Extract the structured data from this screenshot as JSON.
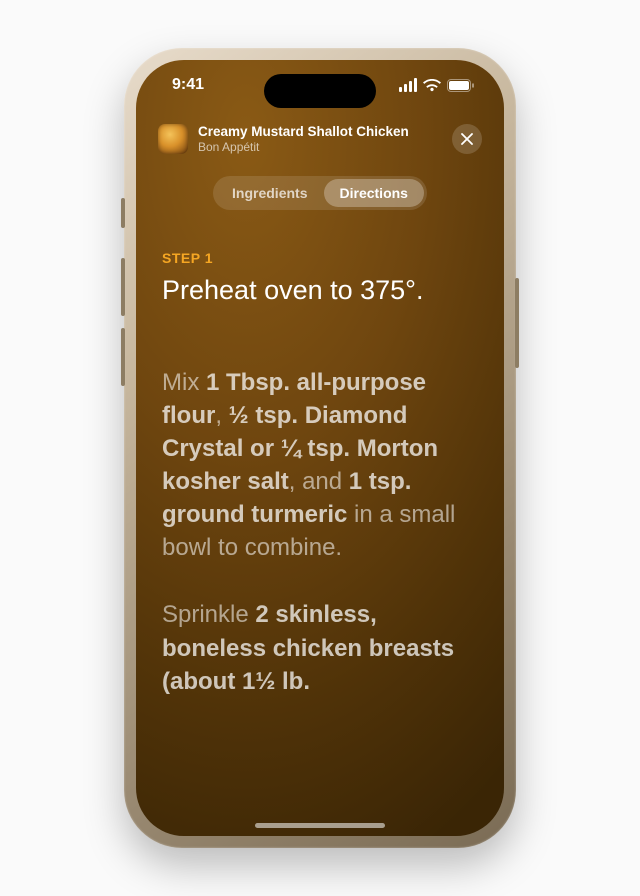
{
  "status": {
    "time": "9:41"
  },
  "header": {
    "title": "Creamy Mustard Shallot Chicken",
    "source": "Bon Appétit",
    "close_icon": "close-icon"
  },
  "tabs": {
    "items": [
      "Ingredients",
      "Directions"
    ],
    "active_index": 1
  },
  "recipe": {
    "step_label": "STEP 1",
    "step_primary": "Preheat oven to 375°.",
    "para2": {
      "p0": "Mix ",
      "b0": "1 Tbsp. all-purpose flour",
      "p1": ", ",
      "b1": "½ tsp. Diamond Crystal or ¼ tsp. Morton kosher salt",
      "p2": ", and ",
      "b2": "1 tsp. ground turmeric",
      "p3": " in a small bowl to combine."
    },
    "para3": {
      "p0": "Sprinkle ",
      "b0": "2 skinless, boneless chicken breasts (about 1½ lb."
    }
  }
}
